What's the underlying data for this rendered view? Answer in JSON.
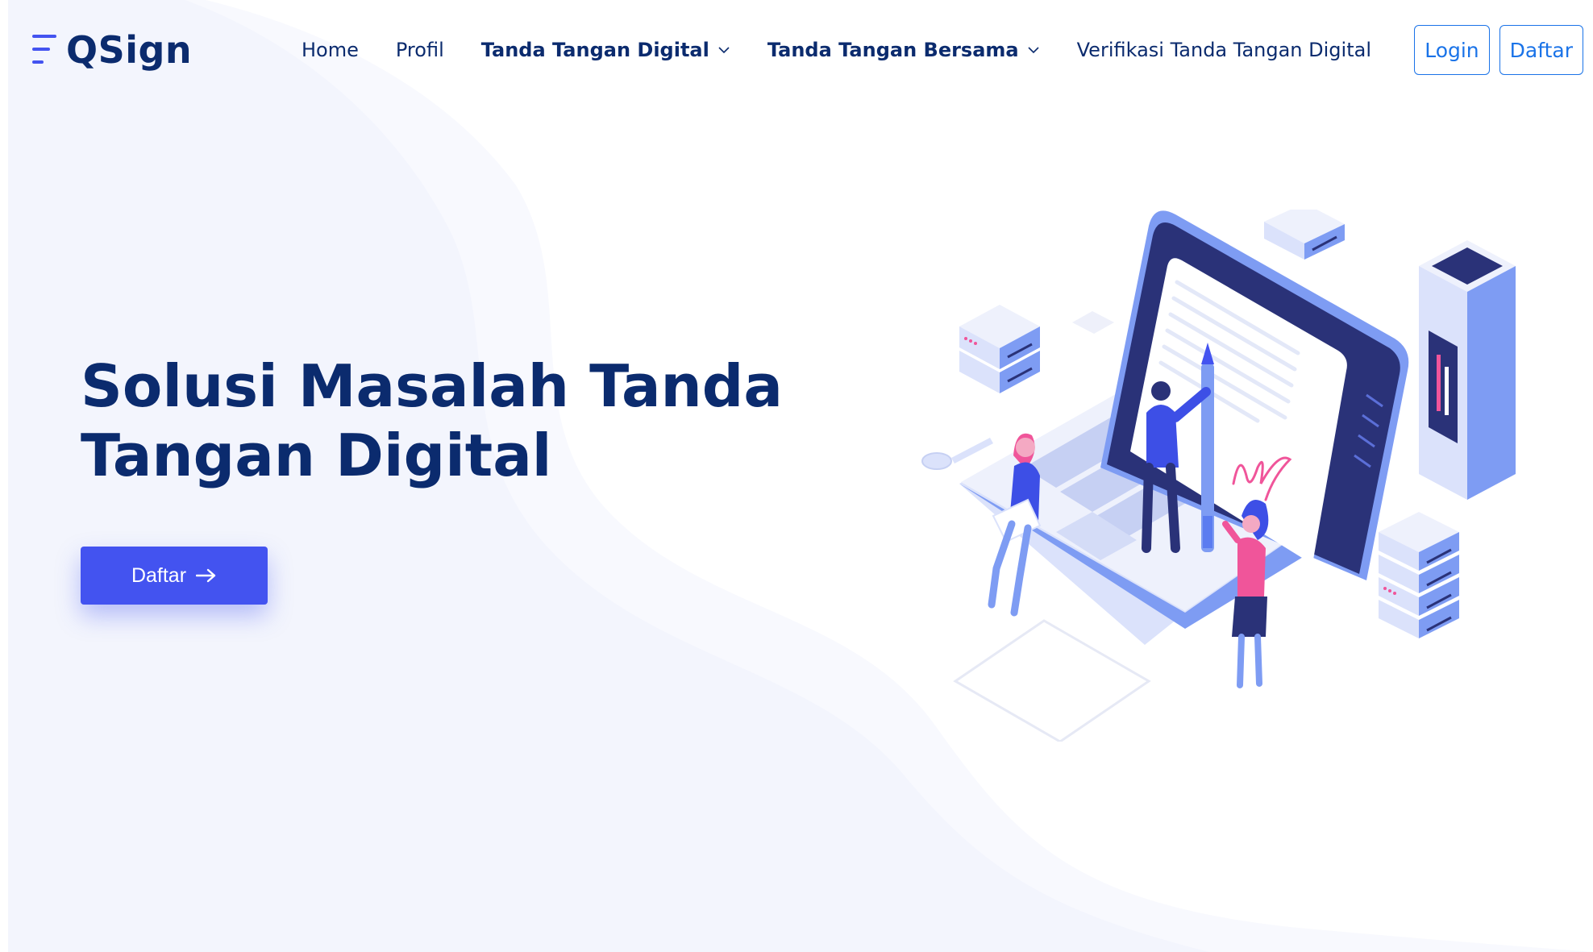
{
  "brand": {
    "name": "QSign",
    "logo_icon": "menu-lines-icon",
    "primary_color": "#0b2b6e",
    "accent_color": "#4353f0",
    "link_color": "#1a73e8"
  },
  "nav": {
    "items": [
      {
        "label": "Home"
      },
      {
        "label": "Profil"
      },
      {
        "label": "Tanda Tangan Digital",
        "has_dropdown": true
      },
      {
        "label": "Tanda Tangan Bersama",
        "has_dropdown": true
      },
      {
        "label": "Verifikasi Tanda Tangan Digital"
      }
    ],
    "dropdown_icon": "chevron-down-icon"
  },
  "auth": {
    "login_label": "Login",
    "register_label": "Daftar"
  },
  "hero": {
    "title_line1": "Solusi Masalah Tanda",
    "title_line2": "Tangan Digital",
    "cta_label": "Daftar",
    "cta_icon": "arrow-right-icon"
  },
  "illustration": {
    "subject": "isometric-laptop-digital-signature-illustration"
  }
}
